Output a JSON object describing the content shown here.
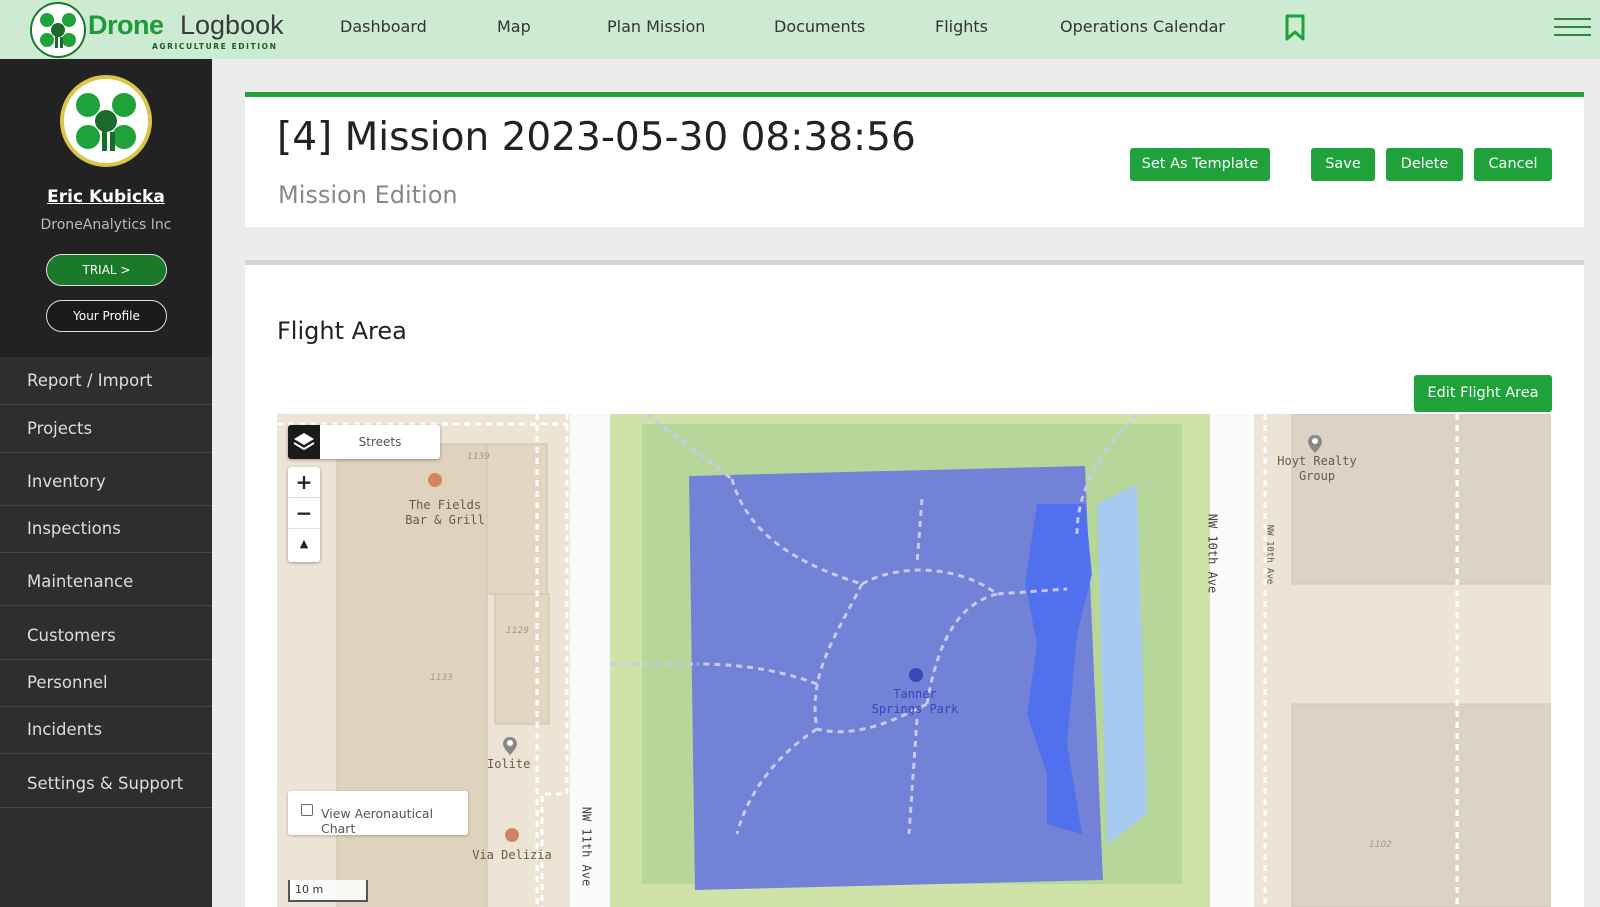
{
  "brand": {
    "name_bold": "Drone",
    "name_light": "Logbook",
    "edition": "AGRICULTURE EDITION"
  },
  "topnav": {
    "items": [
      "Dashboard",
      "Map",
      "Plan Mission",
      "Documents",
      "Flights",
      "Operations Calendar"
    ]
  },
  "user": {
    "name": "Eric Kubicka",
    "company": "DroneAnalytics Inc",
    "trial_label": "TRIAL >",
    "profile_label": "Your Profile"
  },
  "sidebar": {
    "items": [
      {
        "label": "Report / Import"
      },
      {
        "label": "Projects"
      },
      {
        "label": "Inventory"
      },
      {
        "label": "Inspections"
      },
      {
        "label": "Maintenance"
      },
      {
        "label": "Customers"
      },
      {
        "label": "Personnel"
      },
      {
        "label": "Incidents"
      },
      {
        "label": "Settings & Support"
      }
    ]
  },
  "mission": {
    "title": "[4] Mission 2023-05-30 08:38:56",
    "subtitle": "Mission Edition",
    "actions": {
      "template": "Set As Template",
      "save": "Save",
      "delete": "Delete",
      "cancel": "Cancel"
    }
  },
  "flight_area": {
    "title": "Flight Area",
    "edit_label": "Edit Flight Area"
  },
  "map": {
    "layer_label": "Streets",
    "zoom_in": "+",
    "zoom_out": "−",
    "compass": "▲",
    "aero_label": "View Aeronautical Chart",
    "aero_checked": false,
    "scale_label": "10 m",
    "labels": {
      "fields": "The Fields\nBar & Grill",
      "iolite": "Iolite",
      "via": "Via Delizia",
      "park": "Tanner\nSprings Park",
      "hoyt": "Hoyt Realty\nGroup",
      "nw11": "NW 11th Ave",
      "nw10": "NW 10th Ave",
      "nw10_small": "NW 10th Ave"
    },
    "numbers": {
      "n1139": "1139",
      "n1129": "1129",
      "n1133": "1133",
      "n1102": "1102"
    }
  },
  "colors": {
    "brand_green": "#1fa23a",
    "nav_bg": "#cdebd3",
    "sidebar_bg": "#2e2e2e",
    "flight_area_fill": "#6f7ed8"
  }
}
